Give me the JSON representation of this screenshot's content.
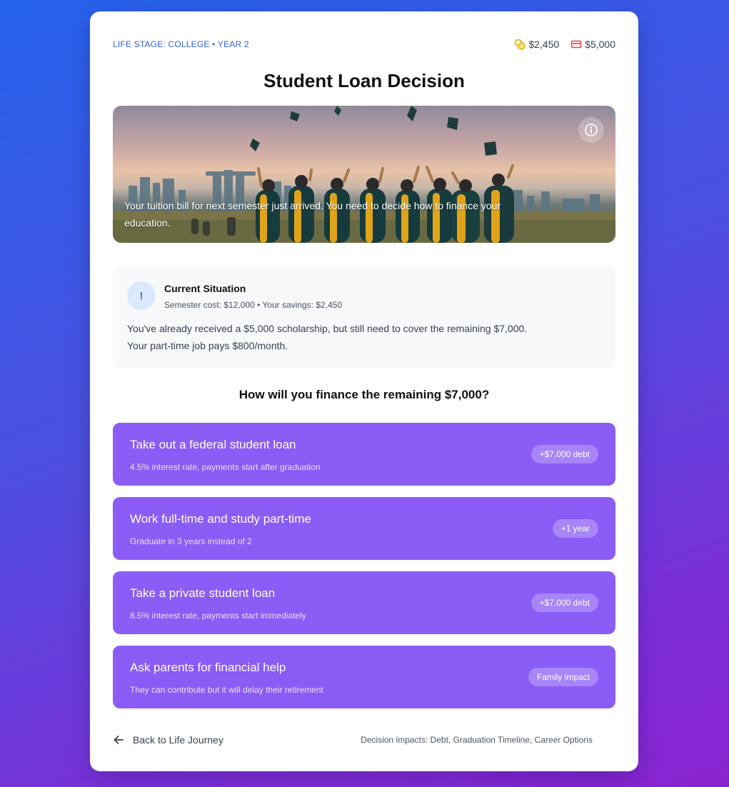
{
  "header": {
    "life_stage": "LIFE STAGE: COLLEGE • YEAR 2",
    "savings": "$2,450",
    "debt": "$5,000",
    "colors": {
      "coin": "#eab308",
      "card": "#ef4444",
      "accent": "#2f5ed8"
    }
  },
  "title": "Student Loan Decision",
  "hero": {
    "caption": "Your tuition bill for next semester just arrived. You need to decide how to finance your education."
  },
  "situation": {
    "icon": "!",
    "title": "Current Situation",
    "subtitle": "Semester cost: $12,000 • Your savings: $2,450",
    "body_line1": "You've already received a $5,000 scholarship, but still need to cover the remaining $7,000.",
    "body_line2": "Your part-time job pays $800/month."
  },
  "question": "How will you finance the remaining $7,000?",
  "options": [
    {
      "title": "Take out a federal student loan",
      "subtitle": "4.5% interest rate, payments start after graduation",
      "badge": "+$7,000 debt"
    },
    {
      "title": "Work full-time and study part-time",
      "subtitle": "Graduate in 3 years instead of 2",
      "badge": "+1 year"
    },
    {
      "title": "Take a private student loan",
      "subtitle": "8.5% interest rate, payments start immediately",
      "badge": "+$7,000 debt"
    },
    {
      "title": "Ask parents for financial help",
      "subtitle": "They can contribute but it will delay their retirement",
      "badge": "Family impact"
    }
  ],
  "footer": {
    "back_label": "Back to Life Journey",
    "impacts": "Decision impacts: Debt, Graduation Timeline, Career Options"
  },
  "option_color": "#8b5cf6"
}
